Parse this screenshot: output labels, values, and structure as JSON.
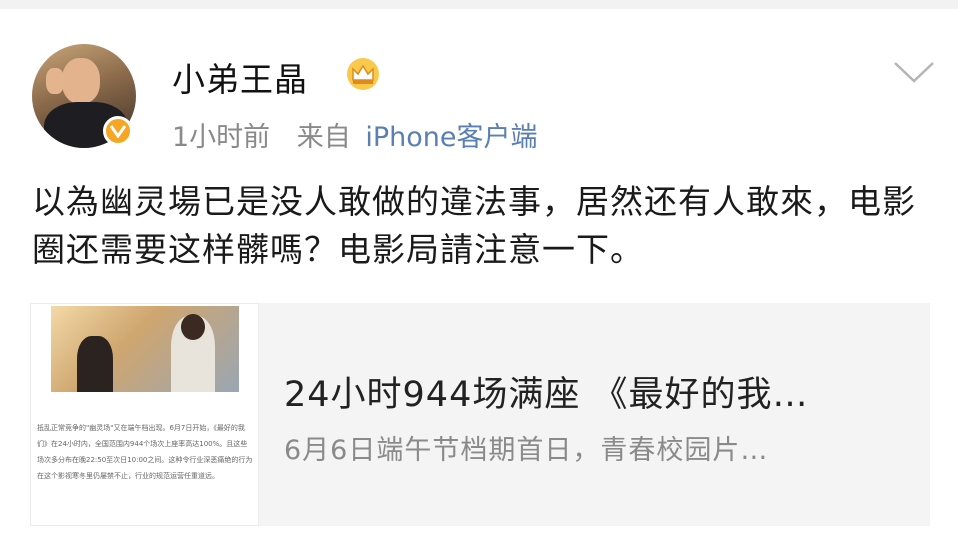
{
  "post": {
    "user": {
      "name": "小弟王晶",
      "avatar_icon": "avatar-photo",
      "verified_icon": "verified-v-icon",
      "member_icon": "crown-icon"
    },
    "time": "1小时前",
    "from_label": "来自",
    "source": "iPhone客户端",
    "text": "以為幽灵場已是没人敢做的違法事，居然还有人敢來，电影圈还需要这样髒嗎？电影局請注意一下。"
  },
  "card": {
    "title": "24小时944场满座 《最好的我…",
    "description": "6月6日端午节档期首日，青春校园片…",
    "thumb_caption": "抵乱正常竞争的\"幽灵场\"又在端午档出现。6月7日开始，《最好的我们》在24小时内，全国范围内944个场次上座率高达100%。且这些场次多分布在晚22:50至次日10:00之间。这种令行业深恶痛绝的行为在这个影视寒冬里仍屡禁不止，行业的规范运营任重道远。"
  },
  "colors": {
    "accent": "#f5a623",
    "link": "#5a7fb0",
    "muted": "#8a8a8a",
    "card_bg": "#f4f4f4"
  }
}
